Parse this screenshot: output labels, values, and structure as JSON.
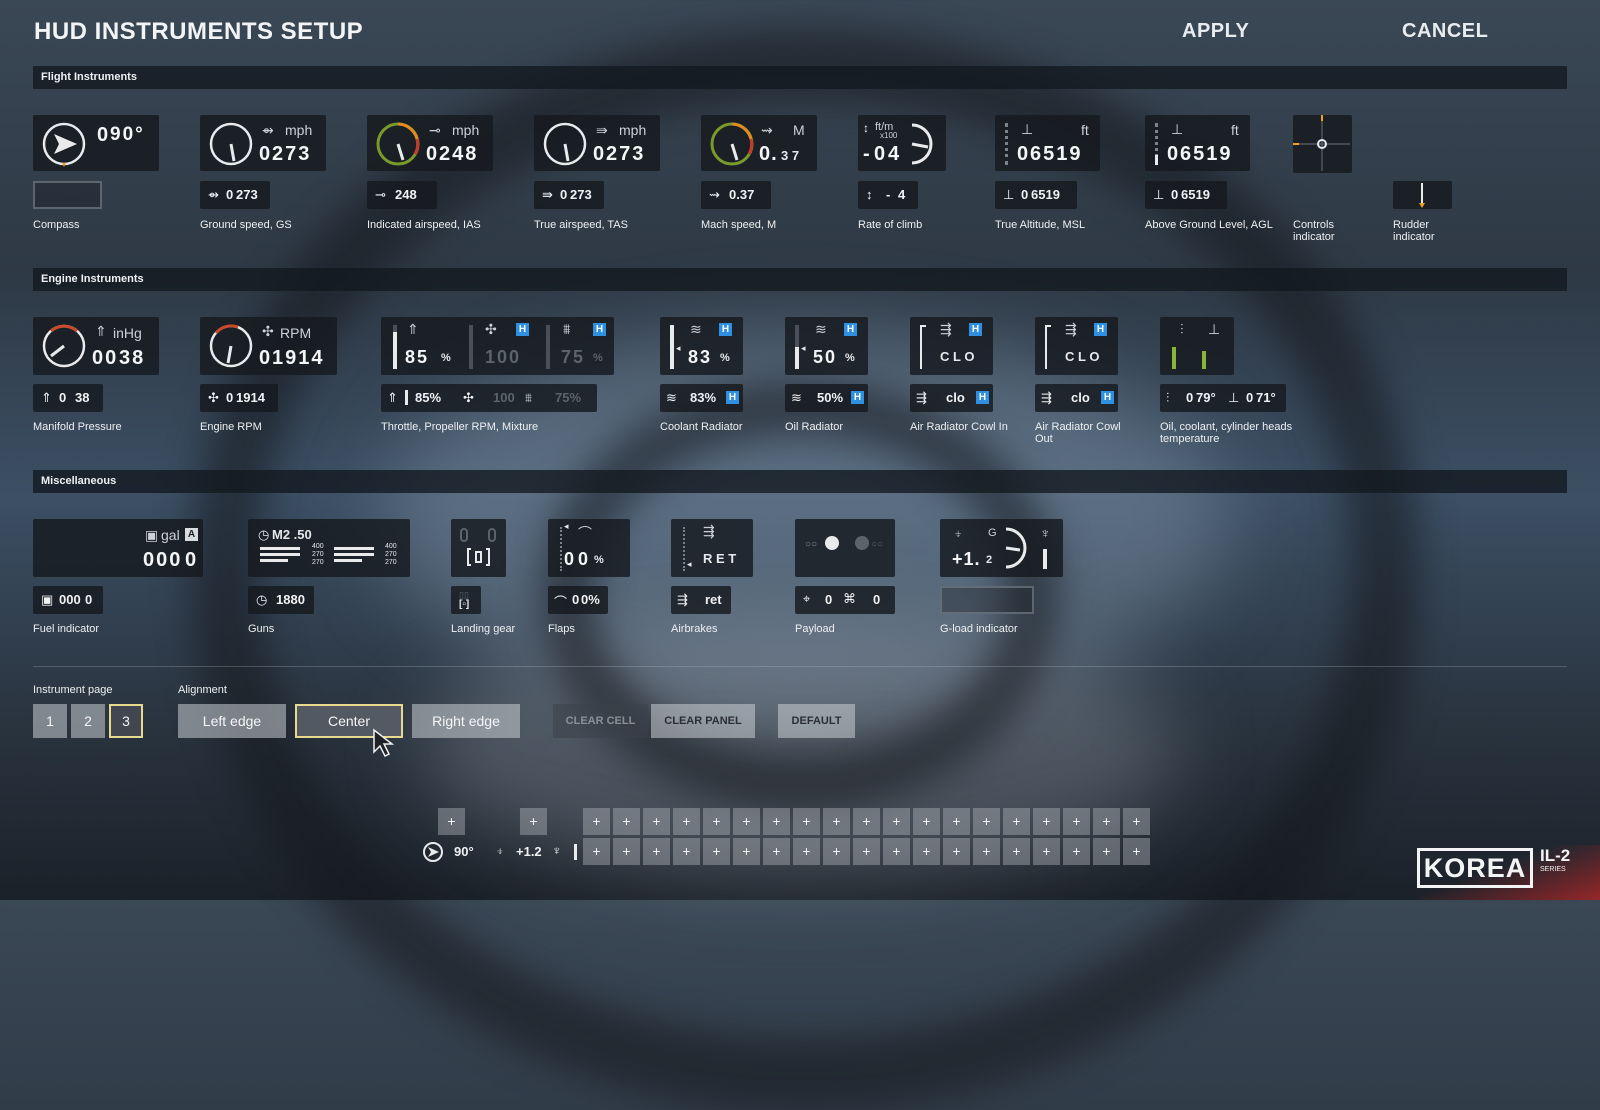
{
  "title": "HUD INSTRUMENTS SETUP",
  "actions": {
    "apply": "APPLY",
    "cancel": "CANCEL"
  },
  "sections": {
    "flight": "Flight Instruments",
    "engine": "Engine Instruments",
    "misc": "Miscellaneous"
  },
  "flight": {
    "compass": {
      "value": "90°",
      "dim": "0",
      "label": "Compass"
    },
    "gs": {
      "unit": "mph",
      "dim": "0",
      "value": "273",
      "small": "273",
      "label": "Ground speed, GS"
    },
    "ias": {
      "unit": "mph",
      "dim": "0",
      "value": "248",
      "small": "248",
      "label": "Indicated airspeed, IAS"
    },
    "tas": {
      "unit": "mph",
      "dim": "0",
      "value": "273",
      "small": "273",
      "label": "True airspeed, TAS"
    },
    "mach": {
      "unit": "M",
      "value": "0.",
      "frac": "3 7",
      "small": "0.37",
      "label": "Mach speed, M"
    },
    "roc": {
      "unit": "ft/m",
      "mult": "x100",
      "sign": "-",
      "dim": "0",
      "value": "4",
      "small_sign": "-",
      "small": "4",
      "label": "Rate of climb"
    },
    "msl": {
      "unit": "ft",
      "dim": "0",
      "value": "6519",
      "small": "6519",
      "label": "True Altitude,  MSL"
    },
    "agl": {
      "unit": "ft",
      "dim": "0",
      "value": "6519",
      "small": "6519",
      "label": "Above Ground Level, AGL"
    },
    "controls": {
      "label": "Controls indicator"
    },
    "rudder": {
      "label": "Rudder indicator"
    }
  },
  "engine": {
    "manifold": {
      "unit": "inHg",
      "dim": "00",
      "value": "38",
      "small_dim": "0",
      "small": "38",
      "label": "Manifold Pressure"
    },
    "rpm": {
      "unit": "RPM",
      "dim": "0",
      "value": "1914",
      "small": "1914",
      "label": "Engine RPM"
    },
    "throttle": {
      "thr": "85",
      "pct": "%",
      "prop": "100",
      "mix": "75",
      "mixpct": "%",
      "h": "H",
      "s_thr": "85%",
      "s_prop": "100",
      "s_mix": "75%",
      "label": "Throttle, Propeller RPM, Mixture"
    },
    "coolant": {
      "value": "83",
      "pct": "%",
      "h": "H",
      "small": "83%",
      "label": "Coolant Radiator"
    },
    "oil": {
      "value": "50",
      "pct": "%",
      "h": "H",
      "small": "50%",
      "label": "Oil Radiator"
    },
    "cowl_in": {
      "value": "C L O",
      "h": "H",
      "small": "clo",
      "label": "Air Radiator Cowl In"
    },
    "cowl_out": {
      "value": "C L O",
      "h": "H",
      "small": "clo",
      "label": "Air Radiator Cowl Out"
    },
    "temps": {
      "dim1": "0",
      "v1": "79°",
      "dim2": "0",
      "v2": "71°",
      "label": "Oil, coolant, cylinder heads temperature"
    }
  },
  "misc": {
    "fuel": {
      "unit": "gal",
      "a": "A",
      "dim": "000",
      "value": "0",
      "small_dim": "000",
      "small": "0",
      "label": "Fuel indicator"
    },
    "guns": {
      "ammo": "M2 .50",
      "r1": "400",
      "r2": "270",
      "r3": "270",
      "small": "1880",
      "label": "Guns"
    },
    "gear": {
      "label": "Landing gear"
    },
    "flaps": {
      "value": "0",
      "pct": "%",
      "small": "0%",
      "label": "Flaps"
    },
    "airbrakes": {
      "value": "R E T",
      "small": "ret",
      "label": "Airbrakes"
    },
    "payload": {
      "v1": "0",
      "v2": "0",
      "label": "Payload"
    },
    "gload": {
      "g": "G",
      "value": "+1.",
      "frac": "2",
      "label": "G-load indicator"
    }
  },
  "page": {
    "label": "Instrument page",
    "buttons": [
      "1",
      "2",
      "3"
    ],
    "selected": "3"
  },
  "alignment": {
    "label": "Alignment",
    "left": "Left edge",
    "center": "Center",
    "right": "Right edge",
    "selected": "Center"
  },
  "buttons": {
    "clear_cell": "CLEAR CELL",
    "clear_panel": "CLEAR PANEL",
    "default": "DEFAULT"
  },
  "preview": {
    "heading": "90°",
    "gload": "+1.2",
    "plus": "+"
  },
  "logo": {
    "brand": "KOREA",
    "series": "IL-2",
    "sub": "SERIES"
  }
}
